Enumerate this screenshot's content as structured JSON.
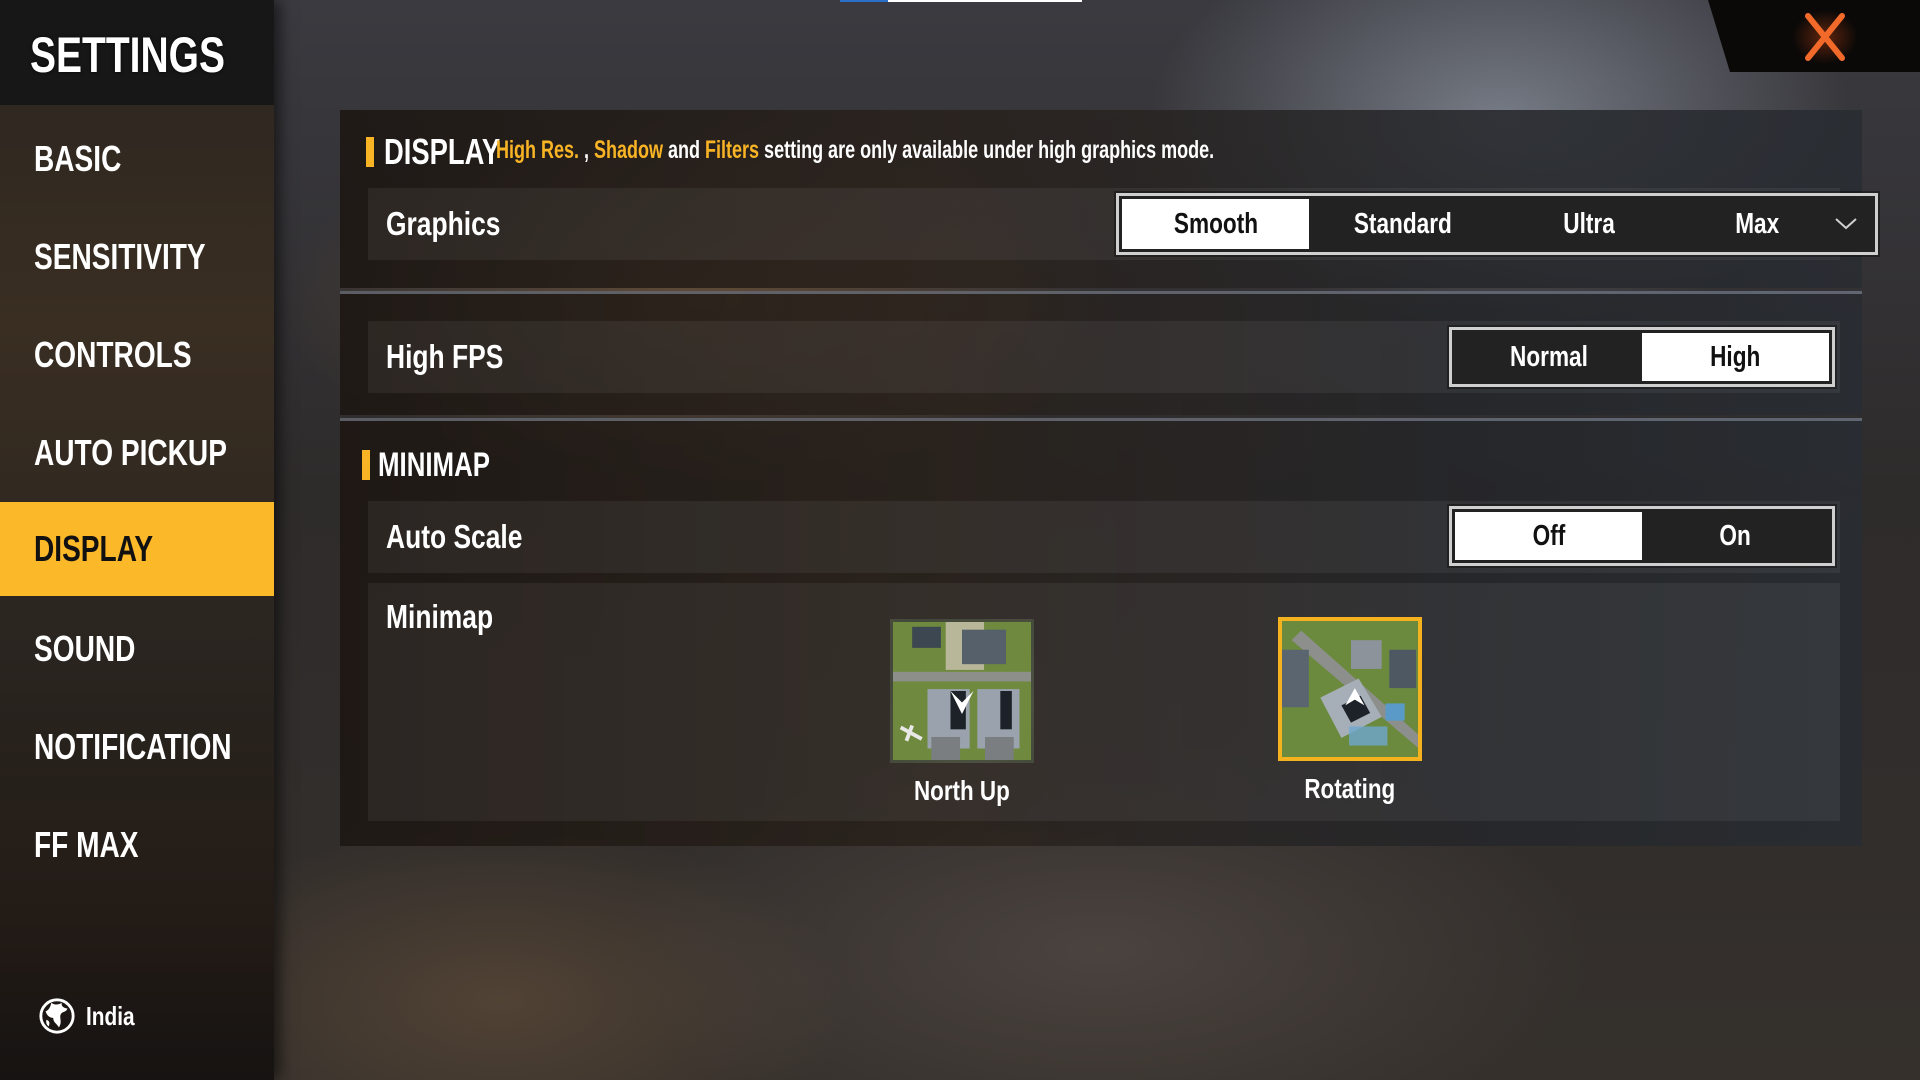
{
  "sidebar": {
    "title": "SETTINGS",
    "items": [
      {
        "label": "BASIC",
        "active": false
      },
      {
        "label": "SENSITIVITY",
        "active": false
      },
      {
        "label": "CONTROLS",
        "active": false
      },
      {
        "label": "AUTO PICKUP",
        "active": false
      },
      {
        "label": "DISPLAY",
        "active": true
      },
      {
        "label": "SOUND",
        "active": false
      },
      {
        "label": "NOTIFICATION",
        "active": false
      },
      {
        "label": "FF MAX",
        "active": false
      }
    ],
    "region": {
      "icon": "globe-icon",
      "label": "India"
    }
  },
  "close": {
    "icon": "close-icon"
  },
  "display": {
    "title": "DISPLAY",
    "notice": {
      "hl1": "High Res.",
      "sep": " , ",
      "hl2": "Shadow",
      "and": " and ",
      "hl3": "Filters",
      "rest": " setting are only available under high graphics mode."
    },
    "graphics": {
      "label": "Graphics",
      "options": [
        "Smooth",
        "Standard",
        "Ultra",
        "Max"
      ],
      "selected": "Smooth",
      "dropdown_icon": "chevron-down-icon"
    },
    "high_fps": {
      "label": "High FPS",
      "options": [
        "Normal",
        "High"
      ],
      "selected": "High"
    }
  },
  "minimap": {
    "title": "MINIMAP",
    "auto_scale": {
      "label": "Auto Scale",
      "options": [
        "Off",
        "On"
      ],
      "selected": "Off"
    },
    "mode": {
      "label": "Minimap",
      "options": [
        {
          "label": "North Up",
          "selected": false
        },
        {
          "label": "Rotating",
          "selected": true
        }
      ]
    }
  },
  "colors": {
    "accent": "#f9b425",
    "selected_option_bg": "#ffffff",
    "close_icon": "#f26a2a"
  }
}
